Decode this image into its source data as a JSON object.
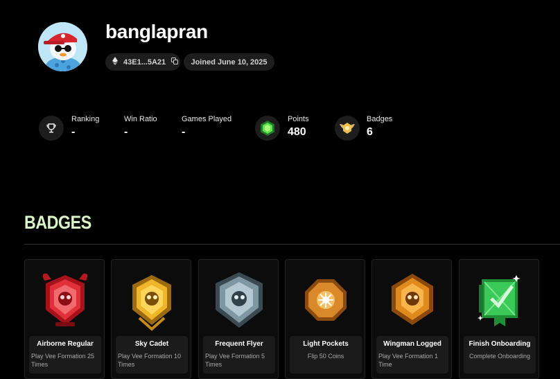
{
  "profile": {
    "username": "banglapran",
    "wallet": "43E1...5A21",
    "joined": "Joined June 10, 2025"
  },
  "stats": {
    "ranking": {
      "label": "Ranking",
      "value": "-"
    },
    "win_ratio": {
      "label": "Win Ratio",
      "value": "-"
    },
    "games_played": {
      "label": "Games Played",
      "value": "-"
    },
    "points": {
      "label": "Points",
      "value": "480"
    },
    "badges": {
      "label": "Badges",
      "value": "6"
    }
  },
  "badges_section": {
    "title": "BADGES",
    "items": [
      {
        "title": "Airborne Regular",
        "desc": "Play Vee Formation 25 Times",
        "color": "#d8222b"
      },
      {
        "title": "Sky Cadet",
        "desc": "Play Vee Formation 10 Times",
        "color": "#e0a21c"
      },
      {
        "title": "Frequent Flyer",
        "desc": "Play Vee Formation 5 Times",
        "color": "#6f8794"
      },
      {
        "title": "Light Pockets",
        "desc": "Flip 50 Coins",
        "color": "#d9892a"
      },
      {
        "title": "Wingman Logged",
        "desc": "Play Vee Formation 1 Time",
        "color": "#e08a1e"
      },
      {
        "title": "Finish Onboarding",
        "desc": "Complete Onboarding",
        "color": "#3bc95a"
      }
    ]
  },
  "icons": {
    "ethereum": "ethereum-icon",
    "copy": "copy-icon",
    "trophy": "trophy-icon",
    "points": "gem-icon",
    "badges": "badge-wings-icon"
  }
}
